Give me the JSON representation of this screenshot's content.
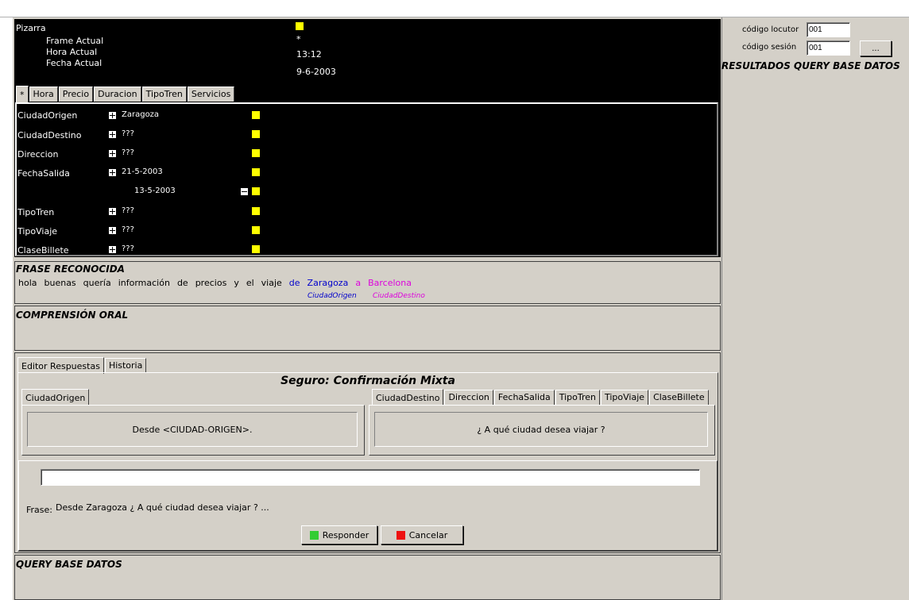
{
  "colors": {
    "highlight_square": "#ffff00",
    "ciudad_origen": "#0000cc",
    "ciudad_destino": "#dd00dd",
    "respond_icon": "#33cc33",
    "cancel_icon": "#ee1111"
  },
  "pizarra": {
    "title": "Pizarra",
    "rows": [
      {
        "label": "Frame Actual",
        "value": "*"
      },
      {
        "label": "Hora Actual",
        "value": "13:12"
      },
      {
        "label": "Fecha Actual",
        "value": "9-6-2003"
      }
    ],
    "tabs": [
      "*",
      "Hora",
      "Precio",
      "Duracion",
      "TipoTren",
      "Servicios"
    ],
    "slots": [
      {
        "name": "CiudadOrigen",
        "value": "Zaragoza"
      },
      {
        "name": "CiudadDestino",
        "value": "???"
      },
      {
        "name": "Direccion",
        "value": "???"
      },
      {
        "name": "FechaSalida",
        "value": "21-5-2003"
      },
      {
        "name": "",
        "value": "13-5-2003"
      },
      {
        "name": "TipoTren",
        "value": "???"
      },
      {
        "name": "TipoViaje",
        "value": "???"
      },
      {
        "name": "ClaseBillete",
        "value": "???"
      }
    ]
  },
  "frase_reconocida": {
    "title": "FRASE RECONOCIDA",
    "words": [
      "hola",
      "buenas",
      "quería",
      "información",
      "de",
      "precios",
      "y",
      "el",
      "viaje",
      "de",
      "Zaragoza",
      "a",
      "Barcelona"
    ],
    "tag_origen": "CiudadOrigen",
    "tag_destino": "CiudadDestino"
  },
  "comprension_oral": {
    "title": "COMPRENSIÓN ORAL"
  },
  "editor": {
    "tabs": [
      "Editor Respuestas",
      "Historia"
    ],
    "header": "Seguro: Confirmación Mixta",
    "left_tabs": [
      "CiudadOrigen"
    ],
    "left_text": "Desde <CIUDAD-ORIGEN>.",
    "right_tabs": [
      "CiudadDestino",
      "Direccion",
      "FechaSalida",
      "TipoTren",
      "TipoViaje",
      "ClaseBillete"
    ],
    "right_text": "¿ A qué ciudad desea viajar ?",
    "input_value": "",
    "frase_label": "Frase:",
    "frase_value": "Desde Zaragoza ¿ A qué ciudad desea viajar ? ...",
    "responder_label": "Responder",
    "cancelar_label": "Cancelar"
  },
  "query": {
    "title": "QUERY BASE DATOS"
  },
  "right_panel": {
    "locutor_label": "código locutor",
    "locutor_value": "001",
    "sesion_label": "código sesión",
    "sesion_value": "001",
    "browse_label": "...",
    "results_title": "RESULTADOS QUERY BASE DATOS"
  }
}
